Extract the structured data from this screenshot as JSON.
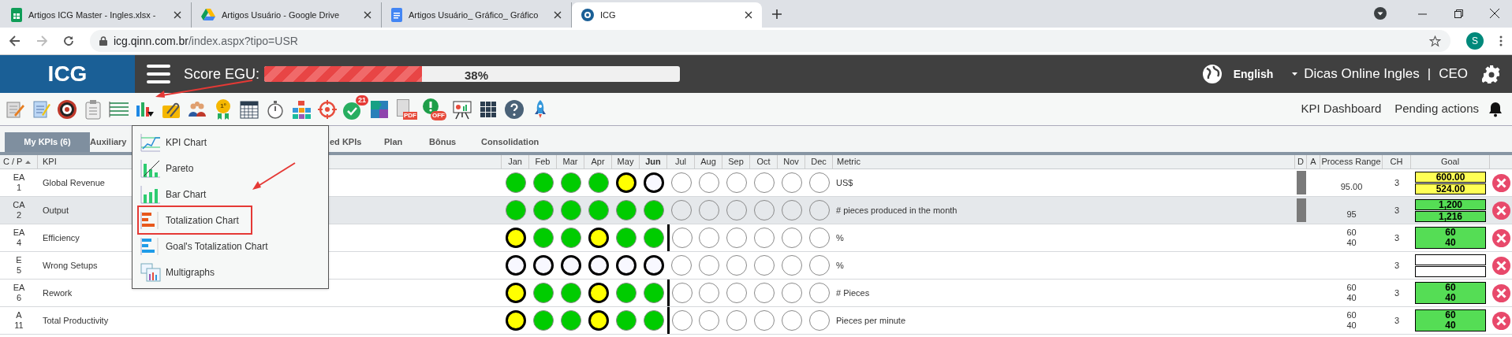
{
  "browser": {
    "tabs": [
      {
        "title": "Artigos ICG Master - Ingles.xlsx -",
        "kind": "sheets",
        "selected": false
      },
      {
        "title": "Artigos Usuário - Google Drive",
        "kind": "drive",
        "selected": false
      },
      {
        "title": "Artigos Usuário_ Gráfico_ Gráfico",
        "kind": "docs",
        "selected": false
      },
      {
        "title": "ICG",
        "kind": "site",
        "selected": true
      }
    ],
    "address": {
      "host": "icg.qinn.com.br",
      "path": "/index.aspx?tipo=USR"
    },
    "profile_initial": "S"
  },
  "header": {
    "logo": "ICG",
    "score_label": "Score EGU:",
    "score": {
      "level": 0.38,
      "reading": "38%"
    },
    "language": "English",
    "user": "Dicas Online Ingles",
    "separator": "|",
    "role": "CEO"
  },
  "toolbar": {
    "medal_label": "1º",
    "badge": "21",
    "pdf_label": "PDF",
    "off_label": "OFF",
    "links": [
      "KPI Dashboard",
      "Pending actions"
    ]
  },
  "tabs": [
    {
      "label": "My KPIs (6)",
      "selected": true
    },
    {
      "label": "Auxiliary",
      "selected": false
    },
    {
      "label": "ed KPIs",
      "selected": false
    },
    {
      "label": "Plan",
      "selected": false
    },
    {
      "label": "Bônus",
      "selected": false
    },
    {
      "label": "Consolidation",
      "selected": false
    }
  ],
  "chart_menu": {
    "items": [
      {
        "label": "KPI Chart",
        "kind": "line",
        "selected": false
      },
      {
        "label": "Pareto",
        "kind": "pareto",
        "selected": false
      },
      {
        "label": "Bar Chart",
        "kind": "bar",
        "selected": false
      },
      {
        "label": "Totalization Chart",
        "kind": "totalization",
        "selected": true
      },
      {
        "label": "Goal's Totalization Chart",
        "kind": "goal_totalization",
        "selected": false
      },
      {
        "label": "Multigraphs",
        "kind": "multi",
        "selected": false
      }
    ]
  },
  "table": {
    "columns": {
      "cp": "C / P",
      "kpi": "KPI",
      "months": [
        {
          "label": "Jan",
          "current": false
        },
        {
          "label": "Feb",
          "current": false
        },
        {
          "label": "Mar",
          "current": false
        },
        {
          "label": "Apr",
          "current": false
        },
        {
          "label": "May",
          "current": false
        },
        {
          "label": "Jun",
          "current": true
        },
        {
          "label": "Jul",
          "current": false
        },
        {
          "label": "Aug",
          "current": false
        },
        {
          "label": "Sep",
          "current": false
        },
        {
          "label": "Oct",
          "current": false
        },
        {
          "label": "Nov",
          "current": false
        },
        {
          "label": "Dec",
          "current": false
        }
      ],
      "metric": "Metric",
      "d": "D",
      "a": "A",
      "range": "Process Range",
      "ch": "CH",
      "goal": "Goal"
    },
    "rows": [
      {
        "code": "EA",
        "number": "1",
        "kpi": "Global Revenue",
        "selected": false,
        "months": [
          {
            "color": "#00cc00",
            "ring": false
          },
          {
            "color": "#00cc00",
            "ring": false
          },
          {
            "color": "#00cc00",
            "ring": false
          },
          {
            "color": "#00cc00",
            "ring": false
          },
          {
            "color": "#ffff00",
            "ring": true
          },
          {
            "color": "#f8f8ff",
            "ring": true
          },
          {
            "color": "#ffffff",
            "ring": false
          },
          {
            "color": "#ffffff",
            "ring": false
          },
          {
            "color": "#ffffff",
            "ring": false
          },
          {
            "color": "#ffffff",
            "ring": false
          },
          {
            "color": "#ffffff",
            "ring": false
          },
          {
            "color": "#ffffff",
            "ring": false
          }
        ],
        "cutoff": false,
        "metric": "US$",
        "d_flag": true,
        "range": [
          "95.00"
        ],
        "ch": "3",
        "goal": {
          "kind": "split",
          "color": "#ffff55",
          "values": [
            "600.00",
            "524.00"
          ]
        }
      },
      {
        "code": "CA",
        "number": "2",
        "kpi": "Output",
        "selected": true,
        "months": [
          {
            "color": "#00cc00",
            "ring": false
          },
          {
            "color": "#00cc00",
            "ring": false
          },
          {
            "color": "#00cc00",
            "ring": false
          },
          {
            "color": "#00cc00",
            "ring": false
          },
          {
            "color": "#00cc00",
            "ring": false
          },
          {
            "color": "#00cc00",
            "ring": false
          },
          {
            "color": "#e5e8eb",
            "ring": false
          },
          {
            "color": "#e5e8eb",
            "ring": false
          },
          {
            "color": "#e5e8eb",
            "ring": false
          },
          {
            "color": "#e5e8eb",
            "ring": false
          },
          {
            "color": "#e5e8eb",
            "ring": false
          },
          {
            "color": "#e5e8eb",
            "ring": false
          }
        ],
        "cutoff": false,
        "metric": "# pieces produced in the month",
        "d_flag": true,
        "range": [
          "95"
        ],
        "ch": "3",
        "goal": {
          "kind": "split",
          "color": "#55dd55",
          "values": [
            "1,200",
            "1,216"
          ]
        }
      },
      {
        "code": "EA",
        "number": "4",
        "kpi": "Efficiency",
        "selected": false,
        "months": [
          {
            "color": "#ffff00",
            "ring": true
          },
          {
            "color": "#00cc00",
            "ring": false
          },
          {
            "color": "#00cc00",
            "ring": false
          },
          {
            "color": "#ffff00",
            "ring": true
          },
          {
            "color": "#00cc00",
            "ring": false
          },
          {
            "color": "#00cc00",
            "ring": false
          },
          {
            "color": "#ffffff",
            "ring": false
          },
          {
            "color": "#ffffff",
            "ring": false
          },
          {
            "color": "#ffffff",
            "ring": false
          },
          {
            "color": "#ffffff",
            "ring": false
          },
          {
            "color": "#ffffff",
            "ring": false
          },
          {
            "color": "#ffffff",
            "ring": false
          }
        ],
        "cutoff": true,
        "metric": "%",
        "d_flag": false,
        "range": [
          "60",
          "40"
        ],
        "ch": "3",
        "goal": {
          "kind": "single",
          "color": "#55dd55",
          "values": [
            "60",
            "40"
          ]
        }
      },
      {
        "code": "E",
        "number": "5",
        "kpi": "Wrong Setups",
        "selected": false,
        "months": [
          {
            "color": "#f8f8ff",
            "ring": true
          },
          {
            "color": "#f8f8ff",
            "ring": true
          },
          {
            "color": "#f8f8ff",
            "ring": true
          },
          {
            "color": "#f8f8ff",
            "ring": true
          },
          {
            "color": "#f8f8ff",
            "ring": true
          },
          {
            "color": "#f8f8ff",
            "ring": true
          },
          {
            "color": "#ffffff",
            "ring": false
          },
          {
            "color": "#ffffff",
            "ring": false
          },
          {
            "color": "#ffffff",
            "ring": false
          },
          {
            "color": "#ffffff",
            "ring": false
          },
          {
            "color": "#ffffff",
            "ring": false
          },
          {
            "color": "#ffffff",
            "ring": false
          }
        ],
        "cutoff": false,
        "metric": "%",
        "d_flag": false,
        "range": [],
        "ch": "3",
        "goal": {
          "kind": "split",
          "color": "#ffffff"
        }
      },
      {
        "code": "EA",
        "number": "6",
        "kpi": "Rework",
        "selected": false,
        "months": [
          {
            "color": "#ffff00",
            "ring": true
          },
          {
            "color": "#00cc00",
            "ring": false
          },
          {
            "color": "#00cc00",
            "ring": false
          },
          {
            "color": "#ffff00",
            "ring": true
          },
          {
            "color": "#00cc00",
            "ring": false
          },
          {
            "color": "#00cc00",
            "ring": false
          },
          {
            "color": "#ffffff",
            "ring": false
          },
          {
            "color": "#ffffff",
            "ring": false
          },
          {
            "color": "#ffffff",
            "ring": false
          },
          {
            "color": "#ffffff",
            "ring": false
          },
          {
            "color": "#ffffff",
            "ring": false
          },
          {
            "color": "#ffffff",
            "ring": false
          }
        ],
        "cutoff": true,
        "metric": "# Pieces",
        "d_flag": false,
        "range": [
          "60",
          "40"
        ],
        "ch": "3",
        "goal": {
          "kind": "single",
          "color": "#55dd55",
          "values": [
            "60",
            "40"
          ]
        }
      },
      {
        "code": "A",
        "number": "11",
        "kpi": "Total Productivity",
        "selected": false,
        "months": [
          {
            "color": "#ffff00",
            "ring": true
          },
          {
            "color": "#00cc00",
            "ring": false
          },
          {
            "color": "#00cc00",
            "ring": false
          },
          {
            "color": "#ffff00",
            "ring": true
          },
          {
            "color": "#00cc00",
            "ring": false
          },
          {
            "color": "#00cc00",
            "ring": false
          },
          {
            "color": "#ffffff",
            "ring": false
          },
          {
            "color": "#ffffff",
            "ring": false
          },
          {
            "color": "#ffffff",
            "ring": false
          },
          {
            "color": "#ffffff",
            "ring": false
          },
          {
            "color": "#ffffff",
            "ring": false
          },
          {
            "color": "#ffffff",
            "ring": false
          }
        ],
        "cutoff": true,
        "metric": "Pieces per minute",
        "d_flag": false,
        "range": [
          "60",
          "40"
        ],
        "ch": "3",
        "goal": {
          "kind": "single",
          "color": "#55dd55",
          "values": [
            "60",
            "40"
          ]
        }
      }
    ]
  }
}
